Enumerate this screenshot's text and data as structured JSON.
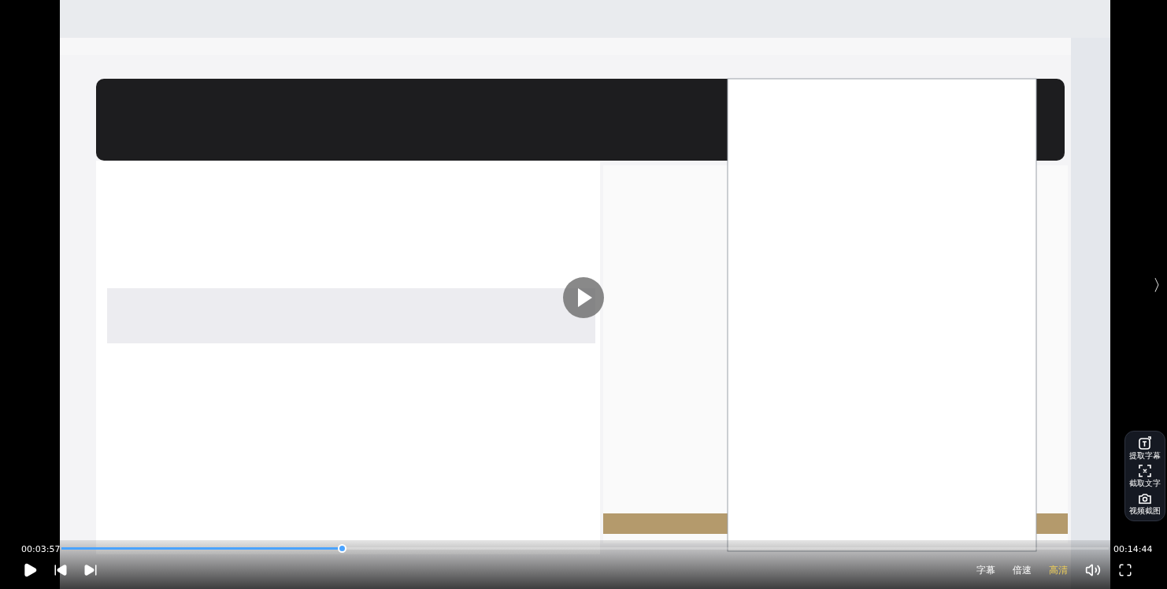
{
  "side_tools": [
    {
      "label": "提取字幕",
      "kind": "subtitle"
    },
    {
      "label": "截取文字",
      "kind": "text"
    },
    {
      "label": "视频截图",
      "kind": "camera"
    }
  ],
  "next_arrow": "〉",
  "player": {
    "current_time": "00:03:57",
    "duration": "00:14:44",
    "level": 0.268,
    "playing": false,
    "buttons": [
      {
        "label": "字幕",
        "selected": false
      },
      {
        "label": "倍速",
        "selected": false
      },
      {
        "label": "高清",
        "selected": true
      }
    ]
  }
}
